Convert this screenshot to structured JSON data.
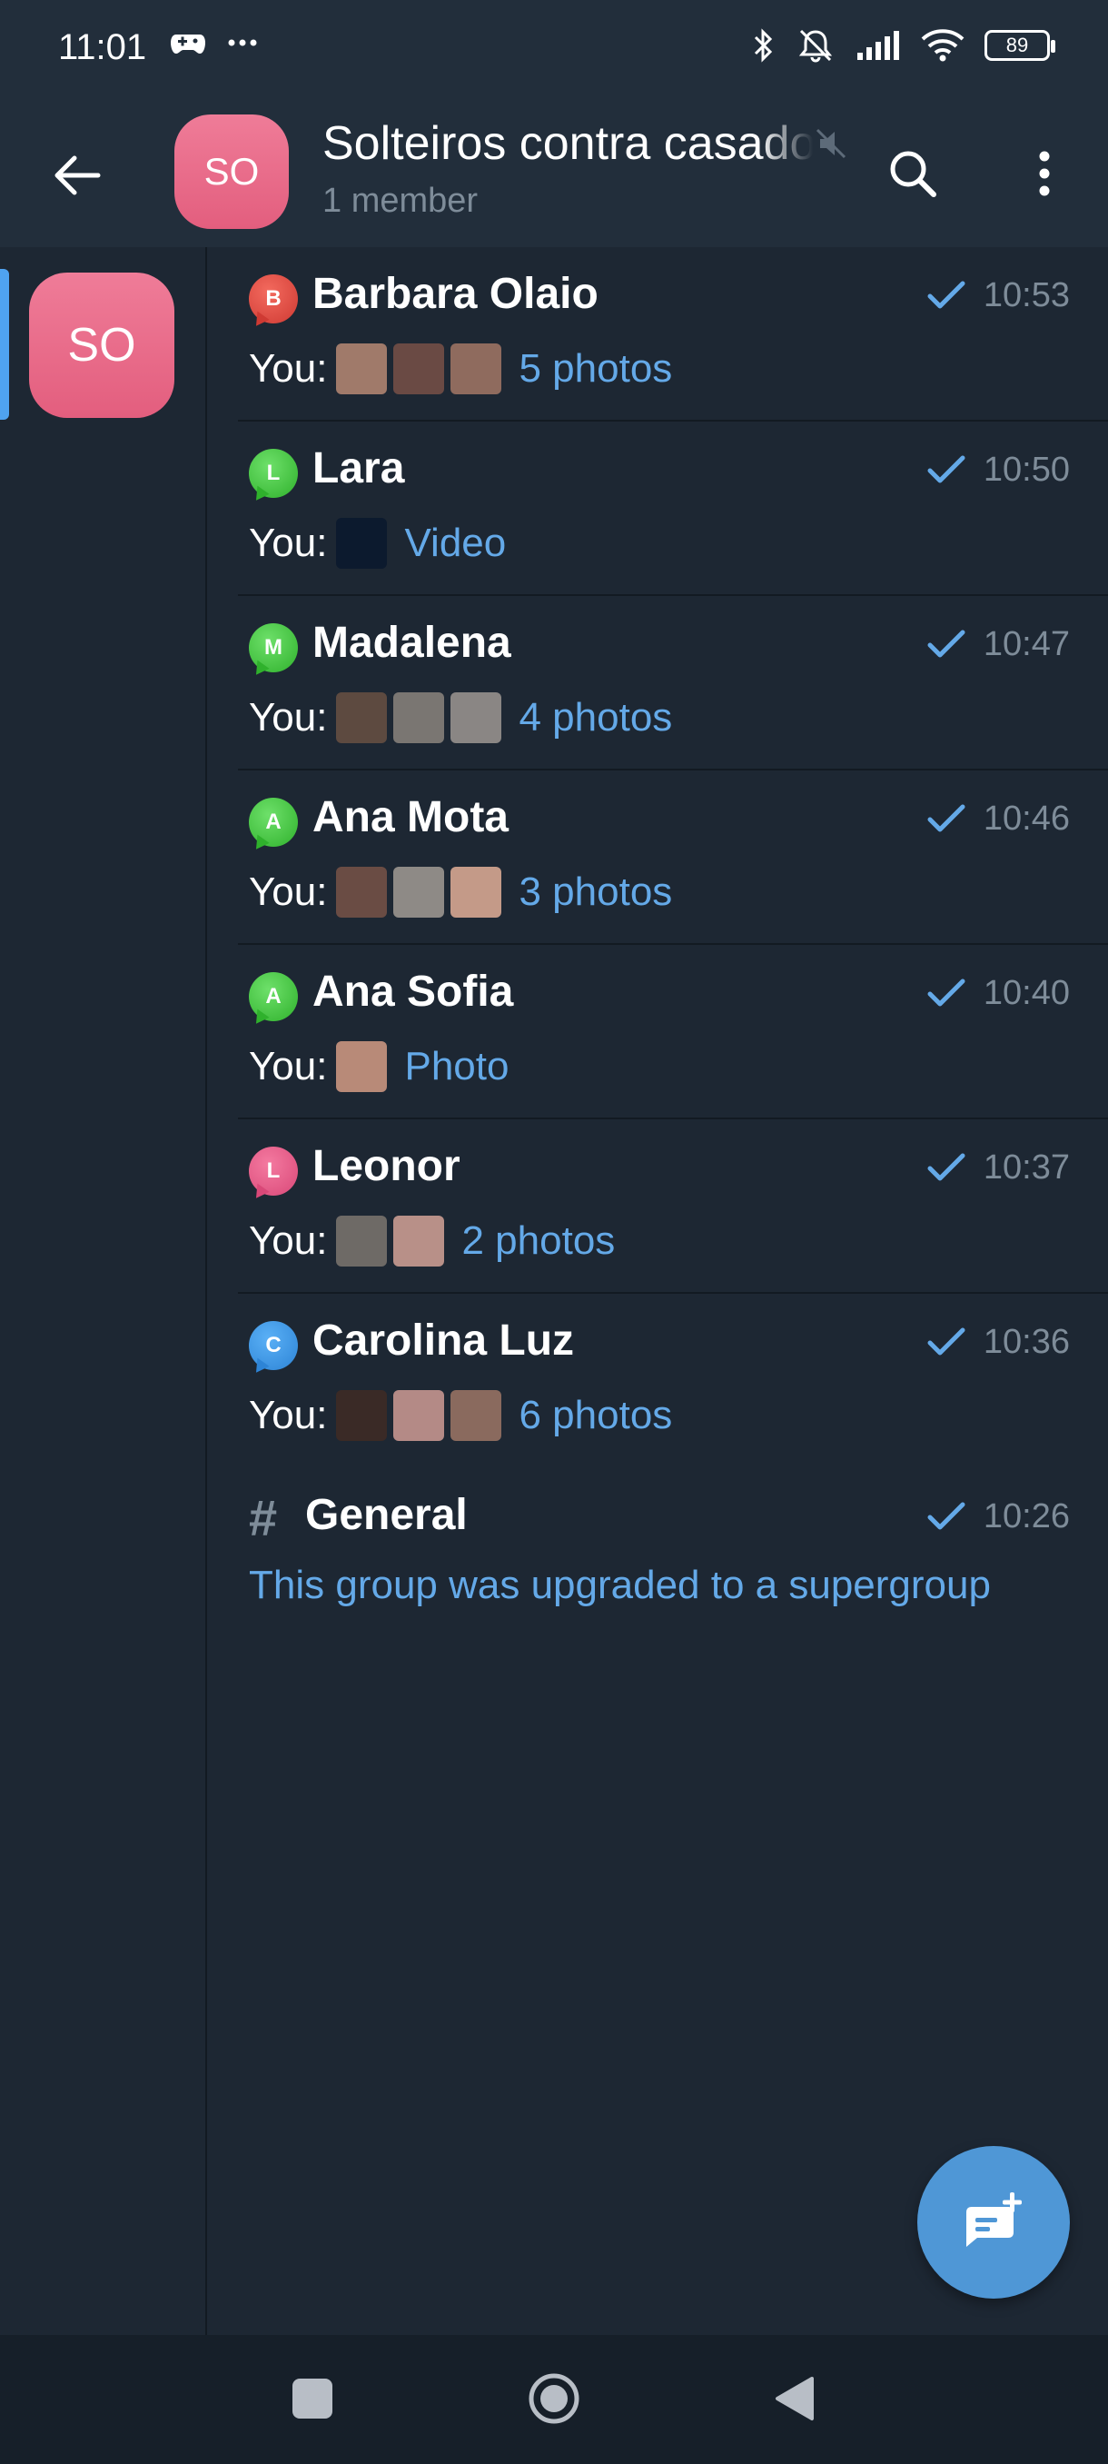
{
  "status_bar": {
    "time": "11:01",
    "battery": "89"
  },
  "header": {
    "title": "Solteiros contra casados",
    "subtitle": "1 member",
    "avatar_initials": "SO"
  },
  "rail": {
    "avatar_initials": "SO"
  },
  "topics": [
    {
      "icon_letter": "B",
      "icon_color": "red",
      "name": "Barbara Olaio",
      "time": "10:53",
      "prefix": "You:",
      "thumbs": [
        "#a07a6a",
        "#6a4a44",
        "#8f6b5e"
      ],
      "media": "5 photos"
    },
    {
      "icon_letter": "L",
      "icon_color": "green",
      "name": "Lara",
      "time": "10:50",
      "prefix": "You:",
      "thumbs": [
        "#0c1a2e"
      ],
      "media": "Video"
    },
    {
      "icon_letter": "M",
      "icon_color": "green",
      "name": "Madalena",
      "time": "10:47",
      "prefix": "You:",
      "thumbs": [
        "#5d4a40",
        "#7a7672",
        "#8a8684"
      ],
      "media": "4 photos"
    },
    {
      "icon_letter": "A",
      "icon_color": "green",
      "name": "Ana Mota",
      "time": "10:46",
      "prefix": "You:",
      "thumbs": [
        "#6a4c44",
        "#8e8a86",
        "#c49a88"
      ],
      "media": "3 photos"
    },
    {
      "icon_letter": "A",
      "icon_color": "green",
      "name": "Ana Sofia",
      "time": "10:40",
      "prefix": "You:",
      "thumbs": [
        "#b88a78"
      ],
      "media": "Photo"
    },
    {
      "icon_letter": "L",
      "icon_color": "pink",
      "name": "Leonor",
      "time": "10:37",
      "prefix": "You:",
      "thumbs": [
        "#6e6a66",
        "#b89088"
      ],
      "media": "2 photos"
    },
    {
      "icon_letter": "C",
      "icon_color": "blue",
      "name": "Carolina Luz",
      "time": "10:36",
      "prefix": "You:",
      "thumbs": [
        "#3a2a26",
        "#b48a86",
        "#8a6a5e"
      ],
      "media": "6 photos"
    }
  ],
  "general": {
    "name": "General",
    "time": "10:26",
    "message": "This group was upgraded to a supergroup"
  },
  "colors": {
    "accent": "#64a9e8",
    "fab": "#4f97d6",
    "avatar": "#e86d8b"
  }
}
